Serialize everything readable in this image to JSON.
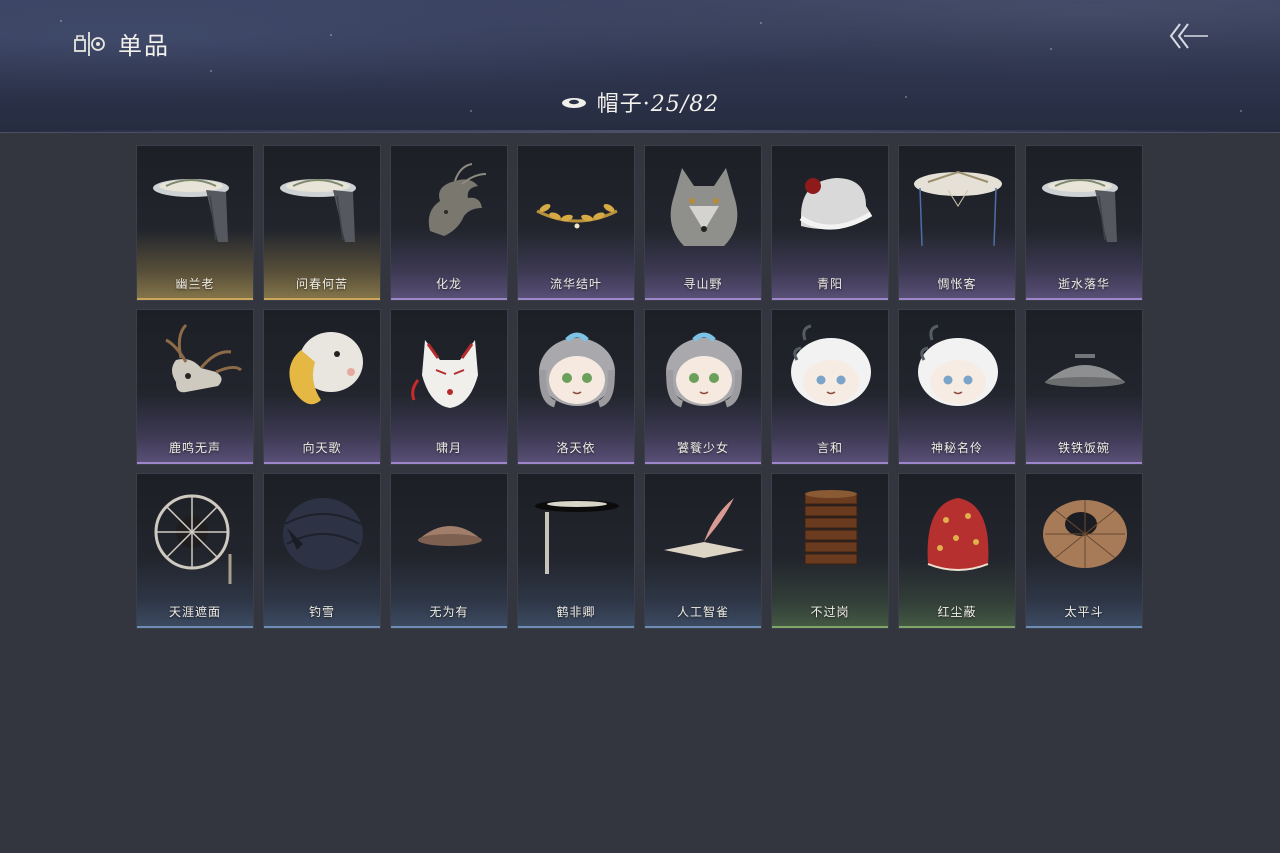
{
  "header": {
    "title": "单品",
    "logo_icon": "collection-logo-icon",
    "back_icon": "back-arrow-icon"
  },
  "category": {
    "icon": "hat-icon",
    "label": "帽子·",
    "count": "25/82"
  },
  "colors": {
    "background": "#33363f",
    "gold": "#c9a65a",
    "purple": "#9d86c9",
    "blue": "#6d8db5",
    "green": "#7ea468"
  },
  "items": [
    {
      "name": "幽兰老",
      "rarity": "gold",
      "icon": "bamboo-hat-veil-icon"
    },
    {
      "name": "问春何苦",
      "rarity": "gold",
      "icon": "bamboo-hat-veil-icon"
    },
    {
      "name": "化龙",
      "rarity": "purple",
      "icon": "dragon-head-icon"
    },
    {
      "name": "流华结叶",
      "rarity": "purple",
      "icon": "golden-leaf-circlet-icon"
    },
    {
      "name": "寻山野",
      "rarity": "purple",
      "icon": "wolf-head-icon"
    },
    {
      "name": "青阳",
      "rarity": "purple",
      "icon": "white-cap-icon"
    },
    {
      "name": "惆怅客",
      "rarity": "purple",
      "icon": "wide-hat-veil-icon"
    },
    {
      "name": "逝水落华",
      "rarity": "purple",
      "icon": "bamboo-hat-veil-icon"
    },
    {
      "name": "鹿鸣无声",
      "rarity": "purple",
      "icon": "deer-skull-icon"
    },
    {
      "name": "向天歌",
      "rarity": "purple",
      "icon": "goose-hood-icon"
    },
    {
      "name": "啸月",
      "rarity": "purple",
      "icon": "fox-mask-icon"
    },
    {
      "name": "洛天依",
      "rarity": "purple",
      "icon": "chibi-head-icon"
    },
    {
      "name": "饕餮少女",
      "rarity": "purple",
      "icon": "chibi-head-icon"
    },
    {
      "name": "言和",
      "rarity": "purple",
      "icon": "chibi-white-head-icon"
    },
    {
      "name": "神秘名伶",
      "rarity": "purple",
      "icon": "chibi-white-head-icon"
    },
    {
      "name": "铁铁饭碗",
      "rarity": "purple",
      "icon": "iron-bowl-icon"
    },
    {
      "name": "天涯遮面",
      "rarity": "blue",
      "icon": "frame-hat-icon"
    },
    {
      "name": "钓雪",
      "rarity": "blue",
      "icon": "dark-straw-hat-icon"
    },
    {
      "name": "无为有",
      "rarity": "blue",
      "icon": "clay-bowl-icon"
    },
    {
      "name": "鹤非卿",
      "rarity": "blue",
      "icon": "flat-black-hat-icon"
    },
    {
      "name": "人工智雀",
      "rarity": "blue",
      "icon": "sparrow-hat-icon"
    },
    {
      "name": "不过岗",
      "rarity": "green",
      "icon": "stacked-bowls-icon"
    },
    {
      "name": "红尘蔽",
      "rarity": "green",
      "icon": "red-hood-icon"
    },
    {
      "name": "太平斗",
      "rarity": "blue",
      "icon": "woven-basket-hat-icon"
    }
  ]
}
